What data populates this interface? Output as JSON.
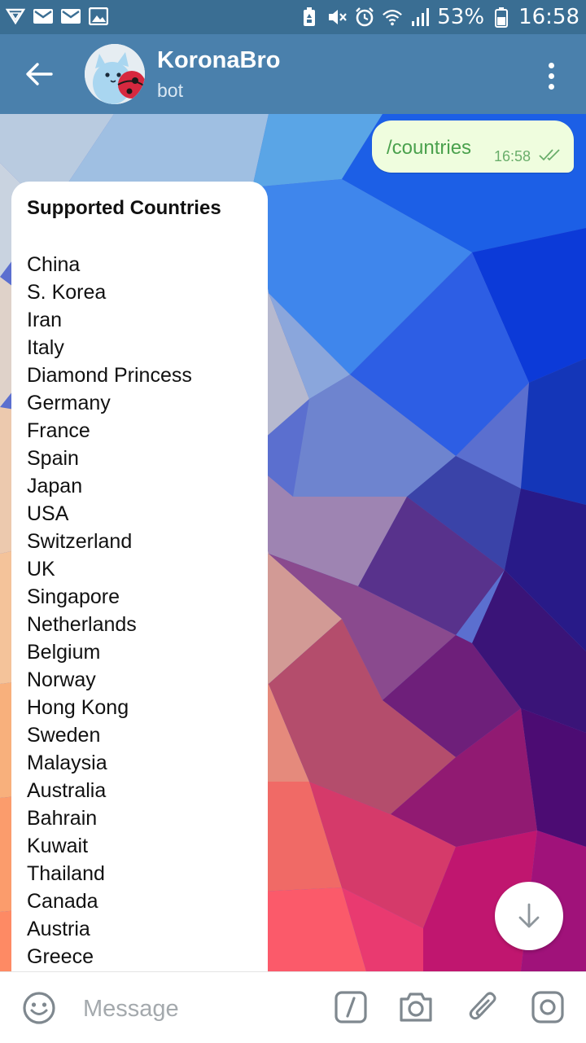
{
  "status_bar": {
    "battery": "53%",
    "time": "16:58",
    "left_icons": [
      "signal-sim-icon",
      "mail-icon",
      "mail-icon",
      "image-icon"
    ],
    "right_icons": [
      "battery-saver-icon",
      "mute-icon",
      "alarm-icon",
      "wifi-icon",
      "signal-icon",
      "battery-icon"
    ]
  },
  "header": {
    "title": "KoronaBro",
    "subtitle": "bot",
    "back_icon": "arrow-left-icon",
    "menu_icon": "more-vertical-icon"
  },
  "messages": {
    "outgoing": {
      "text": "/countries",
      "time": "16:58",
      "status_icon": "double-check-icon"
    },
    "incoming": {
      "title": "Supported Countries",
      "countries": [
        "China",
        "S. Korea",
        "Iran",
        "Italy",
        "Diamond Princess",
        "Germany",
        "France",
        "Spain",
        "Japan",
        "USA",
        "Switzerland",
        "UK",
        "Singapore",
        "Netherlands",
        "Belgium",
        "Norway",
        "Hong Kong",
        "Sweden",
        "Malaysia",
        "Australia",
        "Bahrain",
        "Kuwait",
        "Thailand",
        "Canada",
        "Austria",
        "Greece"
      ]
    }
  },
  "input_bar": {
    "placeholder": "Message",
    "icons": [
      "emoji-icon",
      "bot-command-icon",
      "camera-icon",
      "attach-icon",
      "instagram-camera-icon"
    ]
  },
  "colors": {
    "status_bar": "#3a6e93",
    "toolbar": "#4a80ac",
    "outgoing_bubble": "#effdde",
    "outgoing_text": "#4aa14d"
  }
}
